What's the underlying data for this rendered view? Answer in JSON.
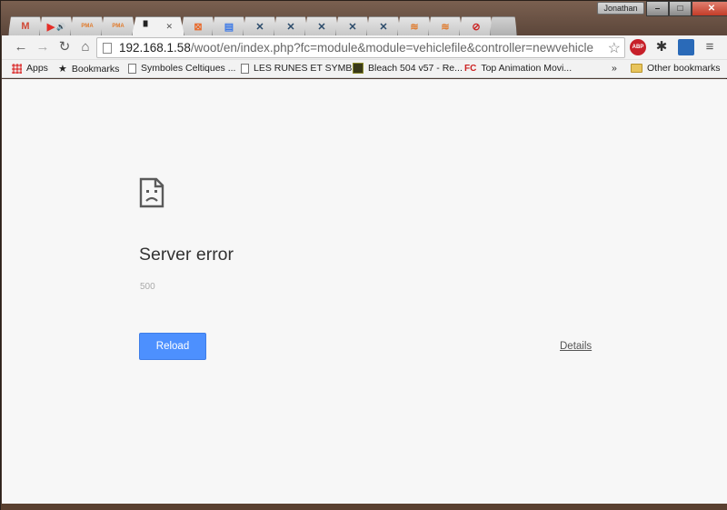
{
  "window": {
    "user_name": "Jonathan",
    "controls": {
      "minimize": "–",
      "maximize": "□",
      "close": "✕"
    }
  },
  "tabs": [
    {
      "icon": "gmail-icon",
      "glyph": "M",
      "color": "#d14836"
    },
    {
      "icon": "youtube-icon",
      "glyph": "▶",
      "color": "#e52d27",
      "audio": "🔊"
    },
    {
      "icon": "pma-icon",
      "glyph": "PMA",
      "color": "#e07a2b"
    },
    {
      "icon": "pma-icon",
      "glyph": "PMA",
      "color": "#e07a2b"
    },
    {
      "icon": "error-page-icon",
      "glyph": "▘",
      "color": "#222",
      "active": true,
      "close": "✕"
    },
    {
      "icon": "pivotal-icon",
      "glyph": "⊠",
      "color": "#e86a2c"
    },
    {
      "icon": "doc-icon",
      "glyph": "▤",
      "color": "#3b78e7"
    },
    {
      "icon": "tool-icon",
      "glyph": "✕",
      "color": "#2a4a6a"
    },
    {
      "icon": "tool-icon",
      "glyph": "✕",
      "color": "#2a4a6a"
    },
    {
      "icon": "tool-icon",
      "glyph": "✕",
      "color": "#2a4a6a"
    },
    {
      "icon": "tool-icon",
      "glyph": "✕",
      "color": "#2a4a6a"
    },
    {
      "icon": "tool-icon",
      "glyph": "✕",
      "color": "#2a4a6a"
    },
    {
      "icon": "stack-icon",
      "glyph": "≋",
      "color": "#e07a2b"
    },
    {
      "icon": "stack-icon",
      "glyph": "≋",
      "color": "#e07a2b"
    },
    {
      "icon": "block-icon",
      "glyph": "⊘",
      "color": "#c22"
    }
  ],
  "toolbar": {
    "back": "←",
    "forward": "→",
    "reload": "↻",
    "home": "⌂",
    "url_host": "192.168.1.58",
    "url_path": "/woot/en/index.php?fc=module&module=vehiclefile&controller=newvehicle",
    "star": "☆",
    "abp_label": "ABP",
    "menu": "≡"
  },
  "bookmarks": {
    "apps": "Apps",
    "bookmarks": "Bookmarks",
    "items": [
      "Symboles Celtiques ...",
      "LES RUNES ET SYMB...",
      "Bleach 504 v57 - Re...",
      "Top Animation Movi..."
    ],
    "overflow": "»",
    "other": "Other bookmarks"
  },
  "error_page": {
    "title": "Server error",
    "code": "500",
    "reload_label": "Reload",
    "details_label": "Details"
  },
  "colors": {
    "reload_button": "#4d90fe",
    "page_background": "#f7f7f7"
  }
}
